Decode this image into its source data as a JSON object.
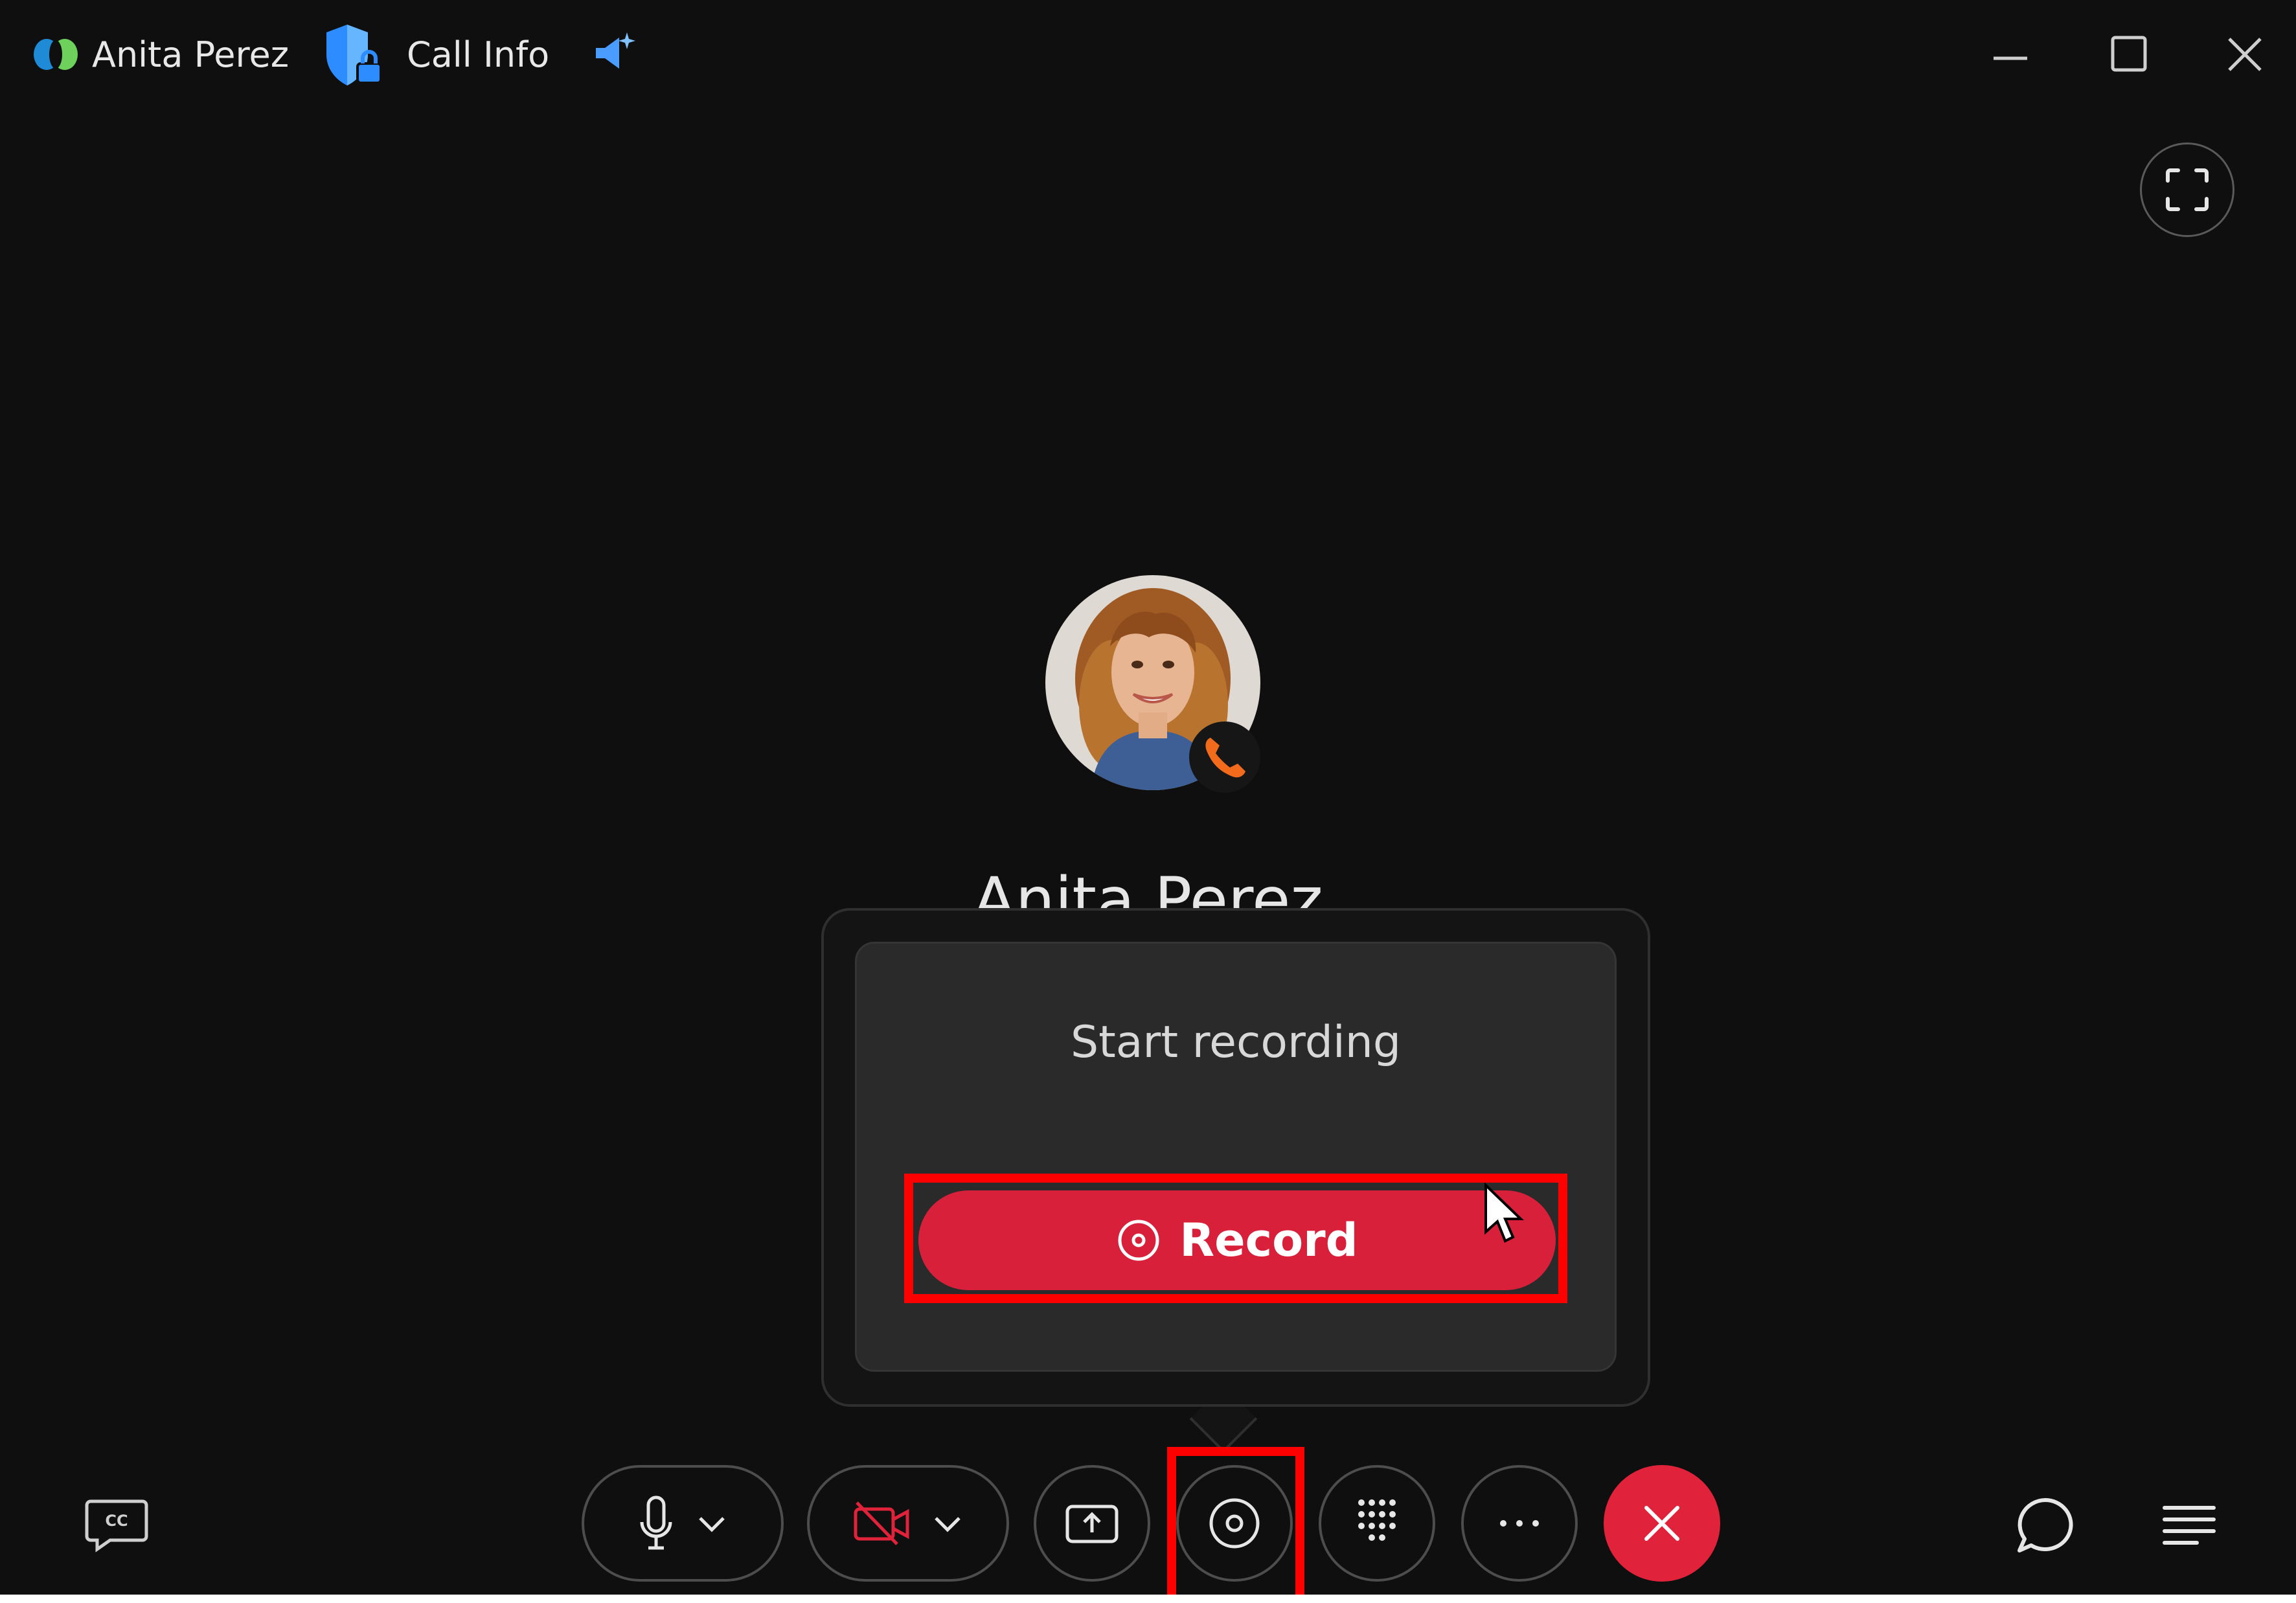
{
  "titlebar": {
    "caller_name": "Anita Perez",
    "call_info_label": "Call Info"
  },
  "participant": {
    "name": "Anita Perez",
    "status_icon": "phone-icon"
  },
  "record_popover": {
    "title": "Start recording",
    "record_button_label": "Record"
  },
  "controls": {
    "left": [
      "closed-captions-icon"
    ],
    "center": [
      "microphone-icon",
      "video-off-icon",
      "share-screen-icon",
      "record-icon",
      "keypad-icon",
      "more-icon",
      "end-call-icon"
    ],
    "right": [
      "chat-icon",
      "participants-list-icon"
    ]
  },
  "colors": {
    "background": "#0f0f0f",
    "record_red": "#d9203a",
    "end_call_red": "#e0233a",
    "highlight_red": "#ff0000",
    "phone_orange": "#f26b1d",
    "accent_blue": "#2d8cff"
  }
}
